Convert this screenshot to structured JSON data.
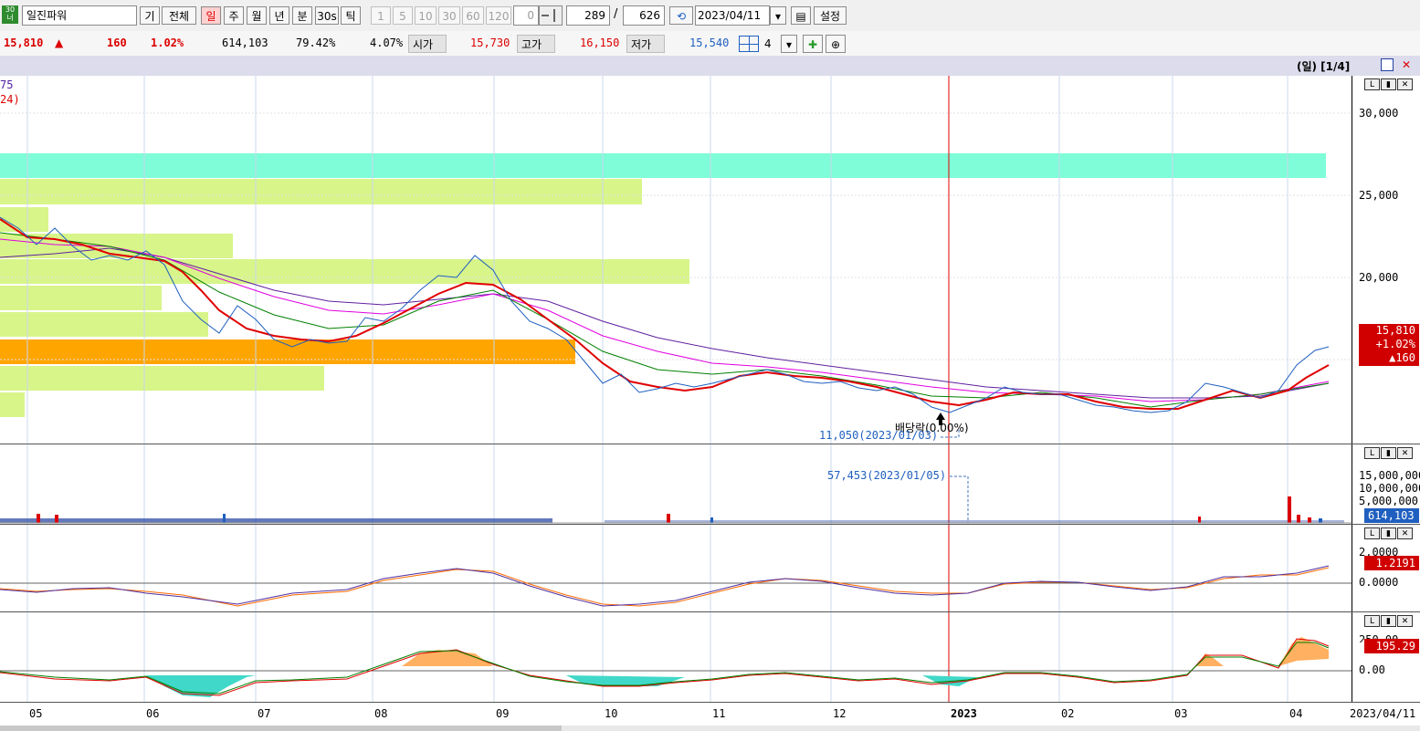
{
  "toolbar": {
    "market_icon": "30\n너",
    "stock_code_input": "일진파워",
    "buttons": [
      "기",
      "전체",
      "일",
      "주",
      "월",
      "년",
      "분",
      "30s",
      "틱"
    ],
    "selected": "일",
    "tick_buttons": [
      "1",
      "5",
      "10",
      "30",
      "60",
      "120"
    ],
    "counter_value": "0",
    "view_count": "289",
    "slash": "/",
    "total_count": "626",
    "date": "2023/04/11",
    "settings_label": "설정"
  },
  "quote": {
    "price": "15,810",
    "direction": "▲",
    "change": "160",
    "change_pct": "1.02%",
    "volume": "614,103",
    "ratio1": "79.42%",
    "ratio2": "4.07%",
    "open_label": "시가",
    "open": "15,730",
    "high_label": "고가",
    "high": "16,150",
    "low_label": "저가",
    "low": "15,540",
    "layout_count": "4"
  },
  "chart": {
    "period_label": "(일) [1/4]",
    "legend_line1": "75",
    "legend_line2": "24)",
    "price_axis": [
      "30,000",
      "25,000",
      "20,000"
    ],
    "price_tag": [
      "15,810",
      "+1.02%",
      "▲160"
    ],
    "dividend_note": "배당락(0.00%)",
    "min_note": "11,050(2023/01/03)",
    "volume_note": "57,453(2023/01/05)",
    "volume_axis": [
      "15,000,000",
      "10,000,000",
      "5,000,000"
    ],
    "volume_tag": "614,103",
    "macd_axis": [
      "2.0000",
      "0.0000"
    ],
    "macd_tag": "1.2191",
    "osc_axis": [
      "250.00",
      "0.00"
    ],
    "osc_tag": "195.29",
    "x_labels": [
      "05",
      "06",
      "07",
      "08",
      "09",
      "10",
      "11",
      "12",
      "2023",
      "02",
      "03",
      "04"
    ],
    "x_end_label": "2023/04/11",
    "colors": {
      "up": "#d00000",
      "down": "#1f5fbf",
      "ma5": "#e00000",
      "ma20": "#008000",
      "ma60": "#e000e0",
      "ma120": "#6020a0",
      "band_cyan": "#7ffcd8",
      "band_lime": "#d8f58a",
      "band_orange": "#ffa500"
    }
  },
  "chart_data": {
    "type": "line",
    "x": [
      "2022-05",
      "2022-06",
      "2022-07",
      "2022-08",
      "2022-09",
      "2022-10",
      "2022-11",
      "2022-12",
      "2023-01",
      "2023-02",
      "2023-03",
      "2023-04"
    ],
    "series": [
      {
        "values": [
          23500,
          21000,
          16500,
          16800,
          19500,
          13800,
          14200,
          14000,
          11800,
          12700,
          12300,
          15810
        ]
      }
    ],
    "ylim": [
      10000,
      31000
    ]
  }
}
